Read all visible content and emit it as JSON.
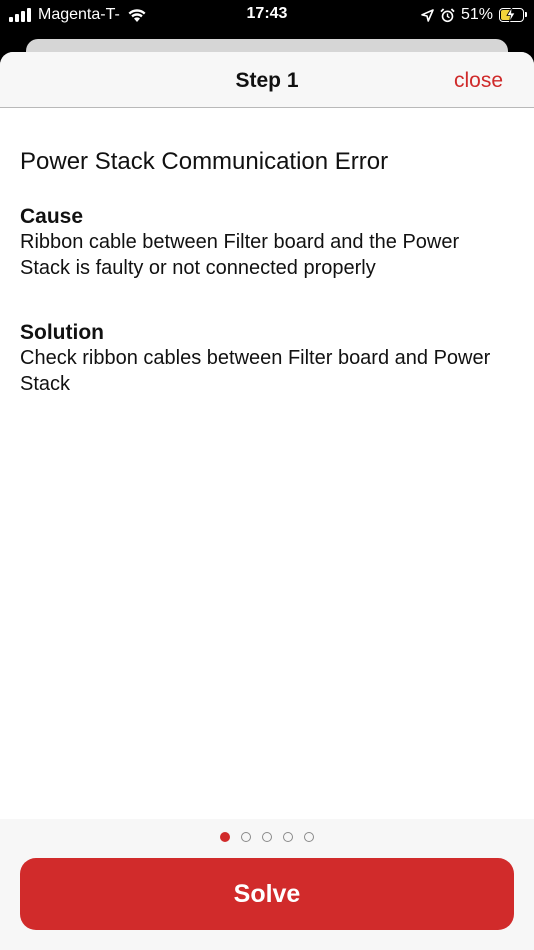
{
  "status_bar": {
    "carrier": "Magenta-T-",
    "time": "17:43",
    "battery_percent": "51%",
    "battery_level": 0.51,
    "battery_color": "#f2d43a"
  },
  "header": {
    "title": "Step 1",
    "close_label": "close"
  },
  "content": {
    "error_title": "Power Stack Communication Error",
    "cause": {
      "heading": "Cause",
      "text": "Ribbon cable between Filter board and the Power Stack is faulty or not connected properly"
    },
    "solution": {
      "heading": "Solution",
      "text": "Check ribbon cables between Filter board and Power Stack"
    }
  },
  "pager": {
    "total": 5,
    "current": 1
  },
  "footer": {
    "solve_label": "Solve"
  },
  "colors": {
    "accent": "#d12b2b"
  }
}
